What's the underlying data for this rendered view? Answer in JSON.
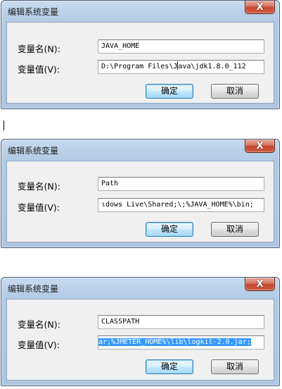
{
  "dialogs": [
    {
      "title": "编辑系统变量",
      "name_label": "变量名(N):",
      "name_value": "JAVA_HOME",
      "value_label": "变量值(V):",
      "value_before_caret": "D:\\Program Files\\J",
      "value_after_caret": "ava\\jdk1.8.0_112",
      "ok_label": "确定",
      "cancel_label": "取消"
    },
    {
      "title": "编辑系统变量",
      "name_label": "变量名(N):",
      "name_value": "Path",
      "value_label": "变量值(V):",
      "value_text": "ιdows Live\\Shared;\\;%JAVA_HOME%\\bin;",
      "ok_label": "确定",
      "cancel_label": "取消"
    },
    {
      "title": "编辑系统变量",
      "name_label": "变量名(N):",
      "name_value": "CLASSPATH",
      "value_label": "变量值(V):",
      "value_text": "ar;%JMETER_HOME%\\lib\\logkit-2.0.jar;",
      "ok_label": "确定",
      "cancel_label": "取消"
    }
  ],
  "close_glyph": "X"
}
